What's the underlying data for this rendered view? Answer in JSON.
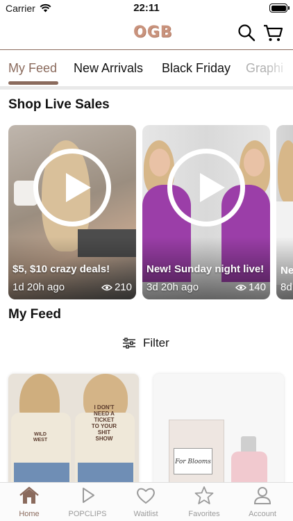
{
  "status_bar": {
    "carrier": "Carrier",
    "time": "22:11",
    "battery_level": 1.0
  },
  "header": {
    "logo_text": "OGB",
    "brand_color": "#8a6a5c",
    "icons": [
      "search-icon",
      "cart-icon"
    ]
  },
  "tabs": [
    {
      "label": "My Feed",
      "active": true
    },
    {
      "label": "New Arrivals",
      "active": false
    },
    {
      "label": "Black Friday",
      "active": false
    },
    {
      "label": "Graphi",
      "active": false
    }
  ],
  "live_sales": {
    "title": "Shop Live Sales",
    "cards": [
      {
        "title": "$5, $10 crazy deals!",
        "time_ago": "1d 20h ago",
        "views": "210"
      },
      {
        "title": "New! Sunday night live!",
        "time_ago": "3d 20h ago",
        "views": "140"
      },
      {
        "title": "Ne",
        "time_ago": "8d",
        "views": ""
      }
    ]
  },
  "feed": {
    "title": "My Feed",
    "filter_label": "Filter",
    "products": [
      {
        "graphic_left": "WILD WEST",
        "graphic_right_lines": [
          "I DON'T",
          "NEED A",
          "TICKET",
          "TO YOUR",
          "SHIT",
          "SHOW"
        ]
      },
      {
        "box_label": "For Blooms"
      }
    ]
  },
  "tabbar": {
    "items": [
      {
        "label": "Home",
        "icon": "home-icon",
        "active": true
      },
      {
        "label": "POPCLIPS",
        "icon": "play-icon",
        "active": false
      },
      {
        "label": "Waitlist",
        "icon": "heart-icon",
        "active": false
      },
      {
        "label": "Favorites",
        "icon": "star-icon",
        "active": false
      },
      {
        "label": "Account",
        "icon": "person-icon",
        "active": false
      }
    ]
  }
}
